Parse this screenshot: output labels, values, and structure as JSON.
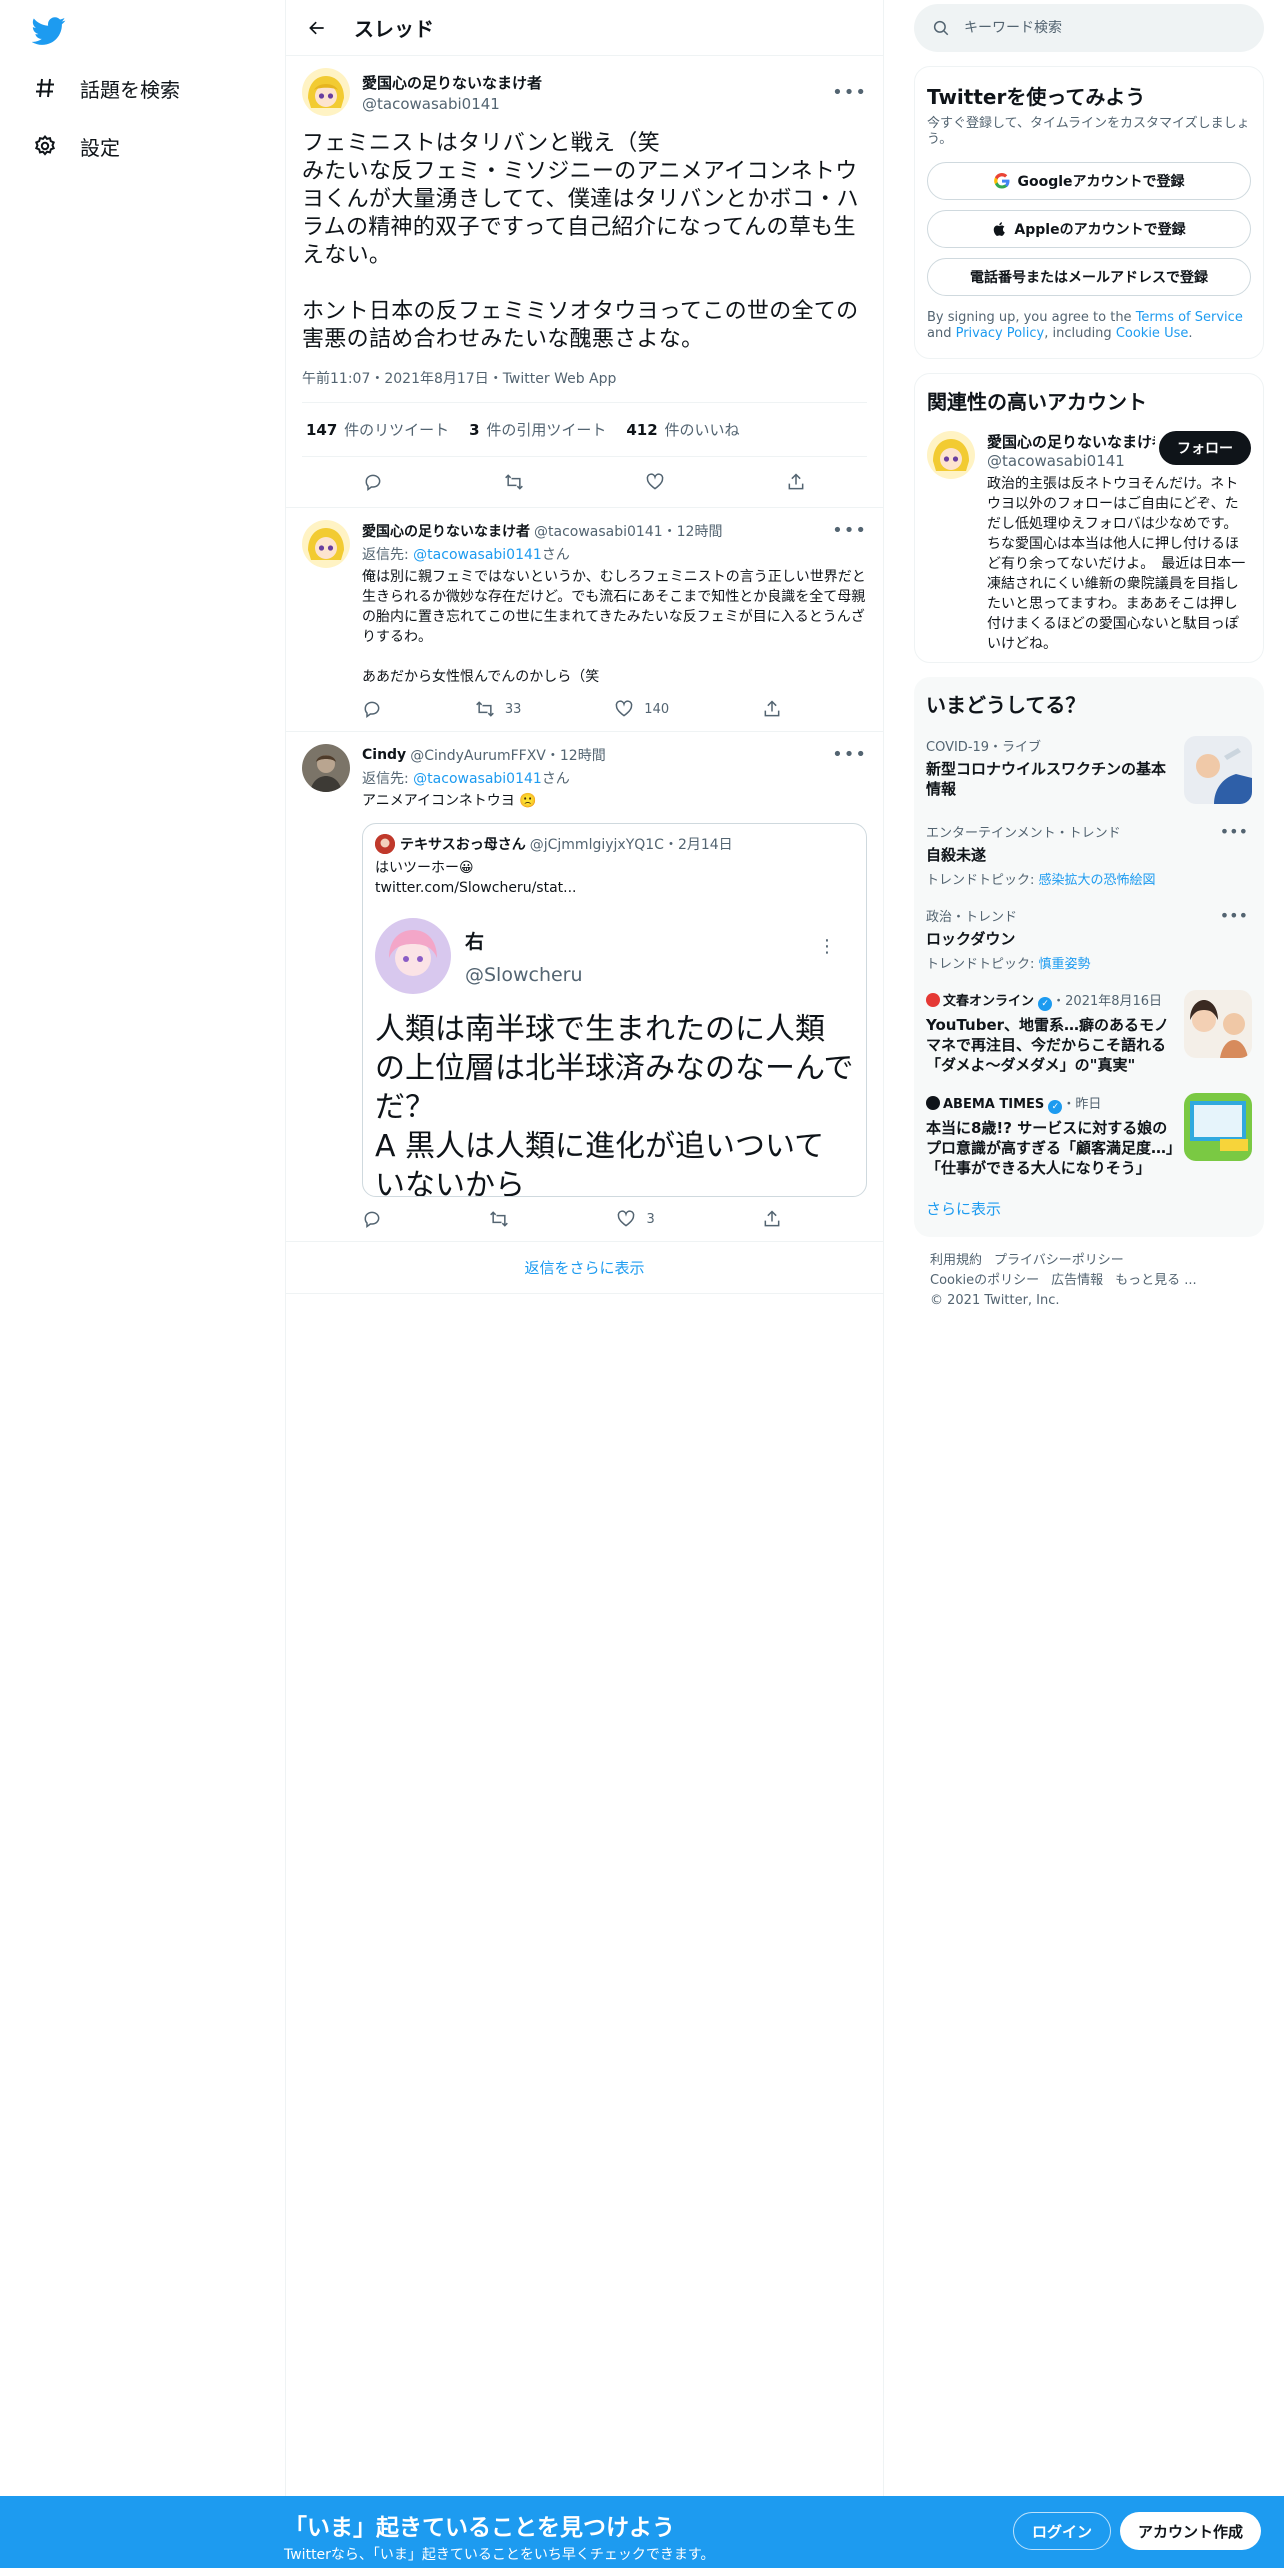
{
  "nav": {
    "explore_label": "話題を検索",
    "settings_label": "設定"
  },
  "header": {
    "title": "スレッド"
  },
  "main_tweet": {
    "display_name": "愛国心の足りないなまけ者",
    "handle": "@tacowasabi0141",
    "text": "フェミニストはタリバンと戦え（笑\nみたいな反フェミ・ミソジニーのアニメアイコンネトウヨくんが大量湧きしてて、僕達はタリバンとかボコ・ハラムの精神的双子ですって自己紹介になってんの草も生えない。\n\nホント日本の反フェミミソオタウヨってこの世の全ての害悪の詰め合わせみたいな醜悪さよな。",
    "meta": "午前11:07・2021年8月17日・Twitter Web App",
    "retweets_count": "147",
    "retweets_label": "件のリツイート",
    "quotes_count": "3",
    "quotes_label": "件の引用ツイート",
    "likes_count": "412",
    "likes_label": "件のいいね"
  },
  "replies": [
    {
      "display_name": "愛国心の足りないなまけ者",
      "meta": "@tacowasabi0141・12時間",
      "replying_prefix": "返信先: ",
      "replying_handle": "@tacowasabi0141",
      "replying_suffix": "さん",
      "text": "俺は別に親フェミではないというか、むしろフェミニストの言う正しい世界だと生きられるか微妙な存在だけど。でも流石にあそこまで知性とか良識を全て母親の胎内に置き忘れてこの世に生まれてきたみたいな反フェミが目に入るとうんざりするわ。\n\nああだから女性恨んでんのかしら（笑",
      "retweets": "33",
      "likes": "140"
    },
    {
      "display_name": "Cindy",
      "meta": "@CindyAurumFFXV・12時間",
      "replying_prefix": "返信先: ",
      "replying_handle": "@tacowasabi0141",
      "replying_suffix": "さん",
      "text": "アニメアイコンネトウヨ 🙁",
      "retweets": "",
      "likes": "3",
      "quote": {
        "display_name": "テキサスおっ母さん",
        "meta": "@jCjmmlgiyjxYQ1C・2月14日",
        "text_line1": "はいツーホー😀",
        "text_line2": "twitter.com/Slowcheru/stat...",
        "card_name": "右",
        "card_handle": "@Slowcheru",
        "card_text": "人類は南半球で生まれたのに人類の上位層は北半球済みなのなーんでだ？\nA 黒人は人類に進化が追いついていないから"
      }
    }
  ],
  "show_more_replies": "返信をさらに表示",
  "search": {
    "placeholder": "キーワード検索"
  },
  "signup": {
    "title": "Twitterを使ってみよう",
    "subtitle": "今すぐ登録して、タイムラインをカスタマイズしましょう。",
    "google_label": "Googleアカウントで登録",
    "apple_label": "Appleのアカウントで登録",
    "phone_label": "電話番号またはメールアドレスで登録",
    "legal_prefix": "By signing up, you agree to the ",
    "terms": "Terms of Service",
    "legal_and": " and ",
    "privacy": "Privacy Policy",
    "legal_including": ", including ",
    "cookie": "Cookie Use",
    "legal_end": "."
  },
  "related": {
    "title": "関連性の高いアカウント",
    "display_name": "愛国心の足りないなまけ者",
    "handle": "@tacowasabi0141",
    "follow_label": "フォロー",
    "bio": "政治的主張は反ネトウヨそんだけ。ネトウヨ以外のフォローはご自由にどぞ、ただし低処理ゆえフォロバは少なめです。　ちな愛国心は本当は他人に押し付けるほど有り余ってないだけよ。　最近は日本一凍結されにくい維新の衆院議員を目指したいと思ってますわ。まああそこは押し付けまくるほどの愛国心ないと駄目っぽいけどね。"
  },
  "trends": {
    "title": "いまどうしてる？",
    "items": [
      {
        "category": "COVID-19・ライブ",
        "name": "新型コロナウイルスワクチンの基本情報",
        "sub_label": "",
        "sub_link": "",
        "has_image": true
      },
      {
        "category": "エンターテインメント・トレンド",
        "name": "自殺未遂",
        "sub_label": "トレンドトピック: ",
        "sub_link": "感染拡大の恐怖絵図",
        "has_image": false
      },
      {
        "category": "政治・トレンド",
        "name": "ロックダウン",
        "sub_label": "トレンドトピック: ",
        "sub_link": "慎重姿勢",
        "has_image": false
      },
      {
        "category": "文春オンライン",
        "date": "・2021年8月16日",
        "name": "YouTuber、地雷系…癖のあるモノマネで再注目、今だからこそ語れる「ダメよ〜ダメダメ」の\"真実\"",
        "sub_label": "",
        "sub_link": "",
        "has_image": true
      },
      {
        "category": "ABEMA TIMES",
        "date": "・昨日",
        "name": "本当に8歳!? サービスに対する娘のプロ意識が高すぎる「顧客満足度…」「仕事ができる大人になりそう」",
        "sub_label": "",
        "sub_link": "",
        "has_image": true
      }
    ],
    "show_more": "さらに表示"
  },
  "footer": {
    "terms": "利用規約",
    "privacy": "プライバシーポリシー",
    "cookie": "Cookieのポリシー",
    "ads": "広告情報",
    "more": "もっと見る ...",
    "copyright": "© 2021 Twitter, Inc."
  },
  "bottom_bar": {
    "headline": "「いま」起きていることを見つけよう",
    "sub": "Twitterなら、「いま」起きていることをいち早くチェックできます。",
    "login_label": "ログイン",
    "signup_label": "アカウント作成"
  },
  "colors": {
    "accent": "#1d9bf0",
    "text": "#0f1419",
    "muted": "#536471",
    "border": "#eff3f4"
  }
}
